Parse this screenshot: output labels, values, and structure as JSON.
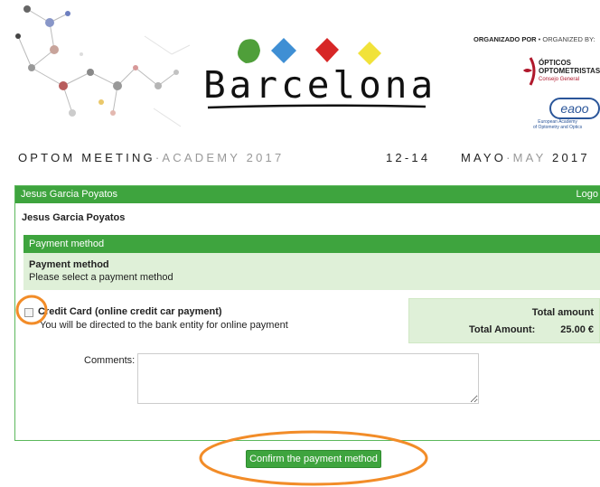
{
  "header": {
    "logo_text": "Barcelona",
    "organized_by_bold": "ORGANIZADO POR",
    "organized_by_rest": " • ORGANIZED BY:",
    "optic_line1": "ÓPTICOS",
    "optic_line2": "OPTOMETRISTAS",
    "optic_sub": "Consejo General",
    "eaoo_caption_1": "European Academy",
    "eaoo_caption_2": "of Optometry and Optics",
    "event_name_dark": "OPTOM MEETING",
    "event_name_sep": "·",
    "event_name_grey": "ACADEMY 2017",
    "event_dates": "12-14",
    "event_month_dark": "MAYO",
    "event_month_sep": "·",
    "event_month_grey": "MAY",
    "event_year": "2017"
  },
  "panel": {
    "user_name_header": "Jesus Garcia Poyatos",
    "logout_label": "Logo",
    "user_name": "Jesus Garcia Poyatos"
  },
  "payment": {
    "section_header": "Payment method",
    "title": "Payment method",
    "instruction": "Please select a payment method",
    "option_title": "Credit Card (online credit car payment)",
    "option_desc": "You will be directed to the bank entity for online payment",
    "option_checked": false
  },
  "totals": {
    "header": "Total amount",
    "label": "Total Amount:",
    "value": "25.00 €"
  },
  "form": {
    "comments_label": "Comments:",
    "comments_value": "",
    "confirm_label": "Confirm the payment method"
  },
  "colors": {
    "brand_green": "#3ea43e",
    "light_green": "#dff0d8",
    "highlight_orange": "#f28c28",
    "optic_red": "#b0182c",
    "eaoo_blue": "#2a5599"
  }
}
